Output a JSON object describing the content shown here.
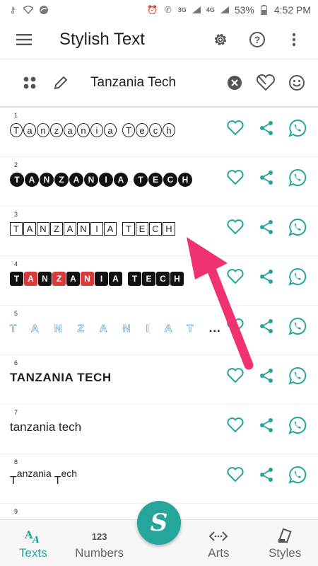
{
  "statusbar": {
    "battery": "53%",
    "time": "4:52 PM",
    "net1": "3G",
    "net2": "4G"
  },
  "appbar": {
    "title": "Stylish Text"
  },
  "input": {
    "value": "Tanzania Tech"
  },
  "rows": [
    {
      "num": "1",
      "text": "Tanzania Tech"
    },
    {
      "num": "2",
      "text": "TANZANIA TECH"
    },
    {
      "num": "3",
      "text": "TANZANIA TECH"
    },
    {
      "num": "4",
      "text": "TANZANIA TECH"
    },
    {
      "num": "5",
      "text": "TANZANIAT",
      "suffix": "..."
    },
    {
      "num": "6",
      "text": "TANZANIA TECH"
    },
    {
      "num": "7",
      "text": "tanzania tech"
    },
    {
      "num": "8",
      "text_low1": "T",
      "text_mid1": "anzania ",
      "text_low2": "T",
      "text_mid2": "ech"
    },
    {
      "num": "9"
    }
  ],
  "nav": {
    "texts": "Texts",
    "numbers": "Numbers",
    "numbers_icon": "123",
    "arts": "Arts",
    "styles": "Styles"
  },
  "colors": {
    "accent": "#26a69a",
    "arrow": "#f0336e",
    "red": "#d93a3a"
  }
}
